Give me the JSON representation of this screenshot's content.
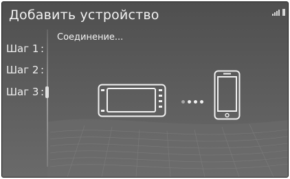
{
  "header": {
    "title": "Добавить устройство"
  },
  "steps": [
    {
      "label": "Шаг 1",
      "separator": ":"
    },
    {
      "label": "Шаг 2",
      "separator": ":"
    },
    {
      "label": "Шаг 3",
      "separator": ":"
    }
  ],
  "status_text": "Соединение...",
  "progress": {
    "dots_total": 4,
    "dots_active": 3
  },
  "icons": {
    "source_device": "head-unit-icon",
    "target_device": "phone-icon",
    "status": [
      "signal-icon",
      "battery-icon"
    ]
  },
  "colors": {
    "background": "#5a5a5a",
    "text": "#f2f2f2"
  }
}
